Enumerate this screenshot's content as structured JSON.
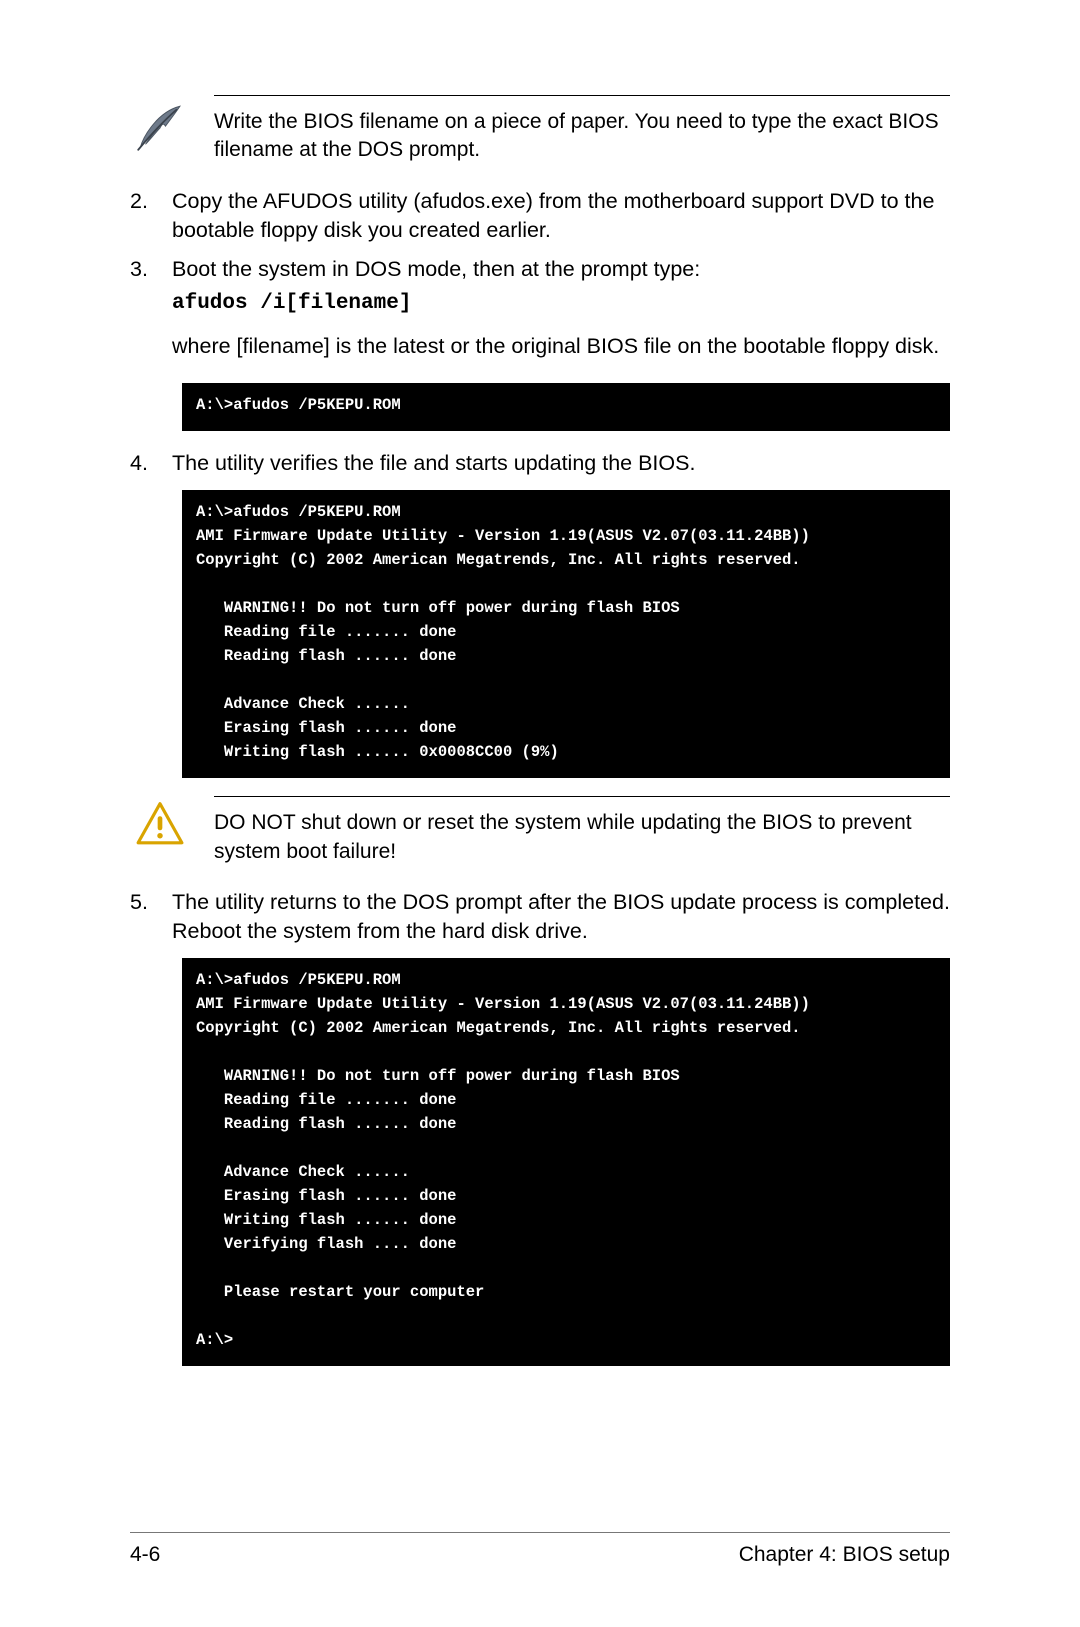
{
  "note1": {
    "text": "Write the BIOS filename on a piece of paper. You need to type the exact BIOS filename at the DOS prompt."
  },
  "step2": {
    "num": "2.",
    "text": "Copy the AFUDOS utility (afudos.exe) from the motherboard support DVD to the bootable floppy disk you created earlier."
  },
  "step3": {
    "num": "3.",
    "text": "Boot the system in DOS mode, then at the prompt type:",
    "cmd": "afudos /i[filename]",
    "tail": "where [filename] is the latest or the original BIOS file on the bootable floppy disk."
  },
  "term1": "A:\\>afudos /P5KEPU.ROM",
  "step4": {
    "num": "4.",
    "text": "The utility verifies the file and starts updating the BIOS."
  },
  "term2": "A:\\>afudos /P5KEPU.ROM\nAMI Firmware Update Utility - Version 1.19(ASUS V2.07(03.11.24BB))\nCopyright (C) 2002 American Megatrends, Inc. All rights reserved.\n\n   WARNING!! Do not turn off power during flash BIOS\n   Reading file ....... done\n   Reading flash ...... done\n\n   Advance Check ......\n   Erasing flash ...... done\n   Writing flash ...... 0x0008CC00 (9%)",
  "note2": {
    "text": "DO NOT shut down or reset the system while updating the BIOS to prevent system boot failure!"
  },
  "step5": {
    "num": "5.",
    "text": "The utility returns to the DOS prompt after the BIOS update process is completed. Reboot the system from the hard disk drive."
  },
  "term3": "A:\\>afudos /P5KEPU.ROM\nAMI Firmware Update Utility - Version 1.19(ASUS V2.07(03.11.24BB))\nCopyright (C) 2002 American Megatrends, Inc. All rights reserved.\n\n   WARNING!! Do not turn off power during flash BIOS\n   Reading file ....... done\n   Reading flash ...... done\n\n   Advance Check ......\n   Erasing flash ...... done\n   Writing flash ...... done\n   Verifying flash .... done\n\n   Please restart your computer\n\nA:\\>",
  "footer": {
    "page": "4-6",
    "chapter": "Chapter 4: BIOS setup"
  }
}
